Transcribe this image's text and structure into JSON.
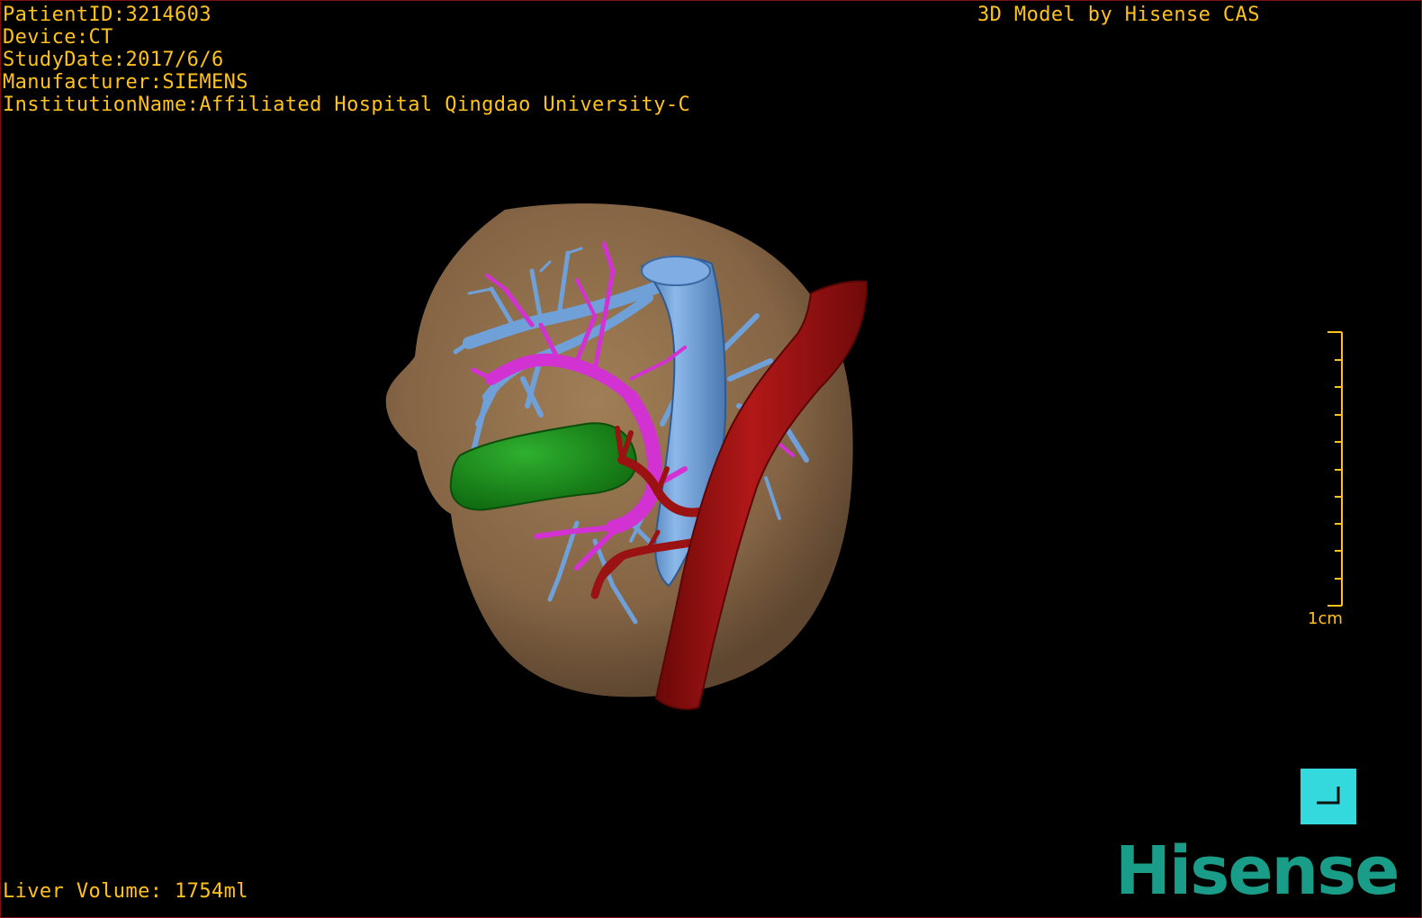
{
  "overlay": {
    "patient_id": "PatientID:3214603",
    "device": "Device:CT",
    "study_date": "StudyDate:2017/6/6",
    "manufacturer": "Manufacturer:SIEMENS",
    "institution": "InstitutionName:Affiliated Hospital Qingdao University-C",
    "model_credit": "3D Model by Hisense CAS",
    "liver_volume": "Liver Volume: 1754ml"
  },
  "scale": {
    "label": "1cm"
  },
  "brand": {
    "logo_text": "Hisense"
  },
  "colors": {
    "overlay_text": "#ffc21a",
    "liver": "#8a6a46",
    "hepatic_vein": "#6fa0d8",
    "portal_vein": "#d232d2",
    "gallbladder": "#1a8a1a",
    "artery": "#9a1212",
    "corner_button": "#33d9dc",
    "brand": "#1a9d88",
    "border": "#7a1010"
  },
  "icons": {
    "corner_button_icon": "corner-bracket-icon"
  }
}
